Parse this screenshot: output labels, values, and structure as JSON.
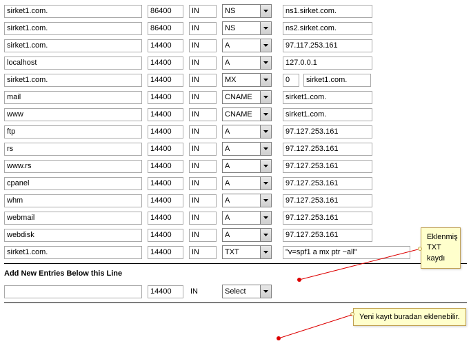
{
  "records": [
    {
      "domain": "sirket1.com.",
      "ttl": "86400",
      "cls": "IN",
      "type": "NS",
      "value": "ns1.sirket.com."
    },
    {
      "domain": "sirket1.com.",
      "ttl": "86400",
      "cls": "IN",
      "type": "NS",
      "value": "ns2.sirket.com."
    },
    {
      "domain": "sirket1.com.",
      "ttl": "14400",
      "cls": "IN",
      "type": "A",
      "value": "97.117.253.161"
    },
    {
      "domain": "localhost",
      "ttl": "14400",
      "cls": "IN",
      "type": "A",
      "value": "127.0.0.1"
    },
    {
      "domain": "sirket1.com.",
      "ttl": "14400",
      "cls": "IN",
      "type": "MX",
      "prio": "0",
      "value": "sirket1.com."
    },
    {
      "domain": "mail",
      "ttl": "14400",
      "cls": "IN",
      "type": "CNAME",
      "value": "sirket1.com."
    },
    {
      "domain": "www",
      "ttl": "14400",
      "cls": "IN",
      "type": "CNAME",
      "value": "sirket1.com."
    },
    {
      "domain": "ftp",
      "ttl": "14400",
      "cls": "IN",
      "type": "A",
      "value": "97.127.253.161"
    },
    {
      "domain": "rs",
      "ttl": "14400",
      "cls": "IN",
      "type": "A",
      "value": "97.127.253.161"
    },
    {
      "domain": "www.rs",
      "ttl": "14400",
      "cls": "IN",
      "type": "A",
      "value": "97.127.253.161"
    },
    {
      "domain": "cpanel",
      "ttl": "14400",
      "cls": "IN",
      "type": "A",
      "value": "97.127.253.161"
    },
    {
      "domain": "whm",
      "ttl": "14400",
      "cls": "IN",
      "type": "A",
      "value": "97.127.253.161"
    },
    {
      "domain": "webmail",
      "ttl": "14400",
      "cls": "IN",
      "type": "A",
      "value": "97.127.253.161"
    },
    {
      "domain": "webdisk",
      "ttl": "14400",
      "cls": "IN",
      "type": "A",
      "value": "97.127.253.161"
    },
    {
      "domain": "sirket1.com.",
      "ttl": "14400",
      "cls": "IN",
      "type": "TXT",
      "value": "\"v=spf1 a mx ptr ~all\"",
      "wide": true
    }
  ],
  "section_title": "Add New Entries Below this Line",
  "new_entry": {
    "domain": "",
    "ttl": "14400",
    "cls": "IN",
    "type": "Select"
  },
  "callout1": "Eklenmiş TXT kaydı",
  "callout2": "Yeni kayıt buradan eklenebilir."
}
